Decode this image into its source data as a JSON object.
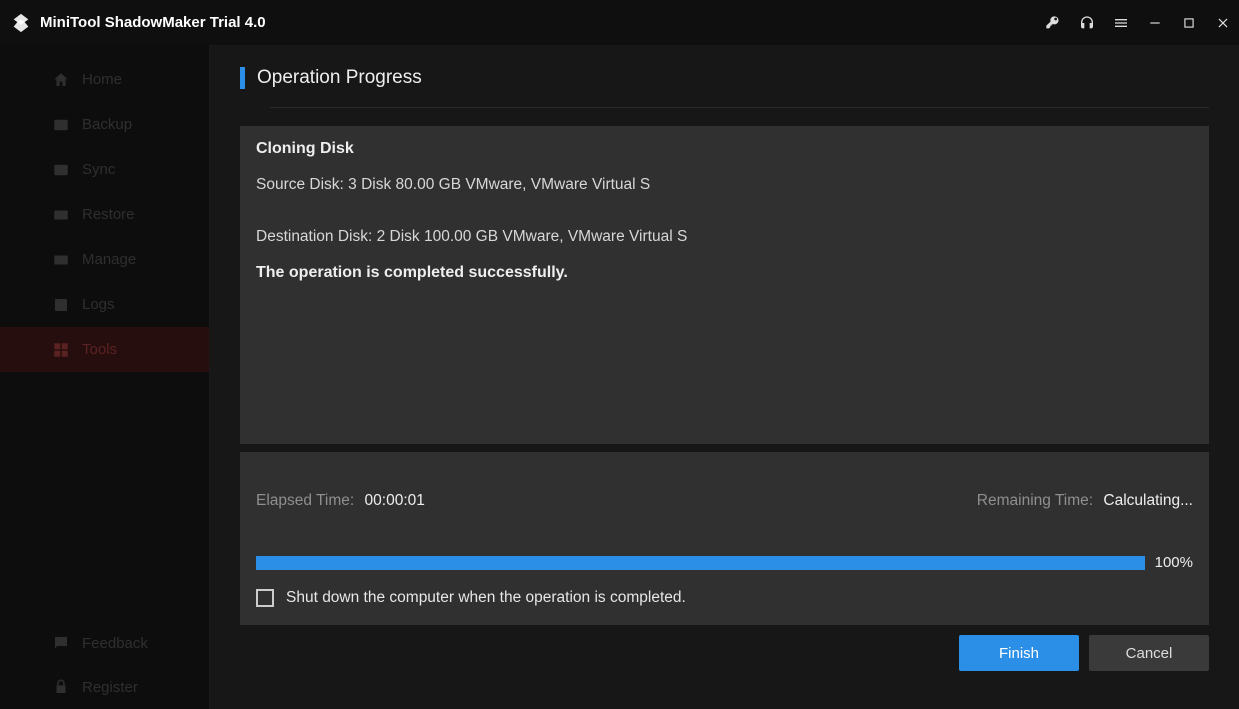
{
  "app": {
    "title": "MiniTool ShadowMaker Trial 4.0"
  },
  "sidebar": {
    "items": [
      {
        "label": "Home"
      },
      {
        "label": "Backup"
      },
      {
        "label": "Sync"
      },
      {
        "label": "Restore"
      },
      {
        "label": "Manage"
      },
      {
        "label": "Logs"
      },
      {
        "label": "Tools"
      }
    ],
    "footer": [
      {
        "label": "Feedback"
      },
      {
        "label": "Register"
      }
    ]
  },
  "page": {
    "title": "Operation Progress",
    "operation_title": "Cloning Disk",
    "source_line": "Source Disk: 3 Disk 80.00 GB VMware, VMware Virtual S",
    "destination_line": "Destination Disk: 2 Disk 100.00 GB VMware, VMware Virtual S",
    "success_line": "The operation is completed successfully.",
    "elapsed_label": "Elapsed Time:",
    "elapsed_value": "00:00:01",
    "remaining_label": "Remaining Time:",
    "remaining_value": "Calculating...",
    "progress_pct": "100%",
    "shutdown_checkbox_label": "Shut down the computer when the operation is completed.",
    "finish_label": "Finish",
    "cancel_label": "Cancel"
  },
  "colors": {
    "accent": "#2b8fe8"
  }
}
